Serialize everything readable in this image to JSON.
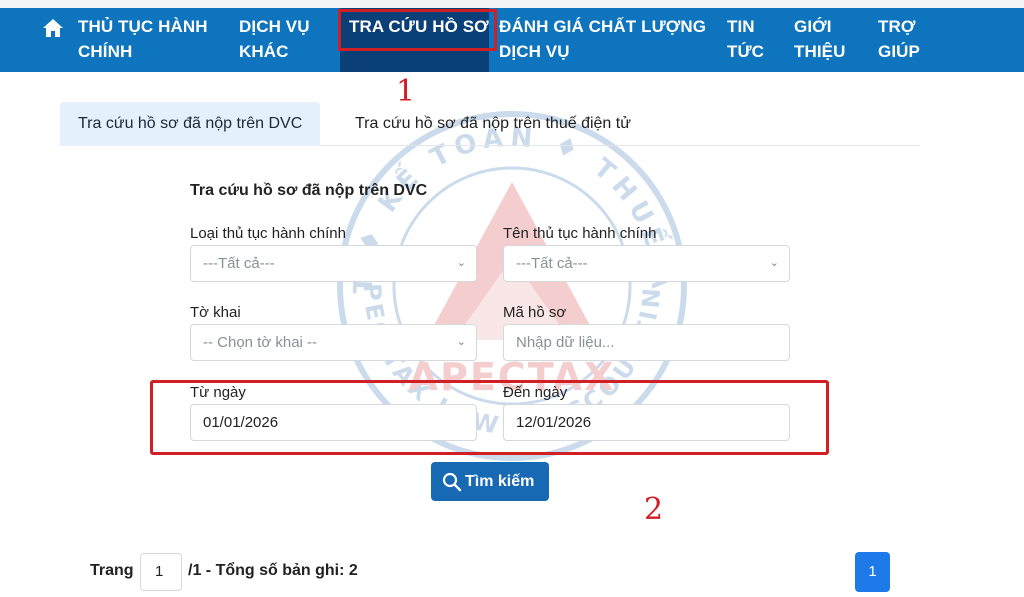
{
  "nav": {
    "home_icon": "home-icon",
    "items": [
      {
        "line1": "THỦ TỤC HÀNH",
        "line2": "CHÍNH"
      },
      {
        "line1": "DỊCH VỤ",
        "line2": "KHÁC"
      },
      {
        "line1": "TRA CỨU HỒ SƠ",
        "line2": ""
      },
      {
        "line1": "ĐÁNH GIÁ CHẤT LƯỢNG",
        "line2": "DỊCH VỤ"
      },
      {
        "line1": "TIN",
        "line2": "TỨC"
      },
      {
        "line1": "GIỚI",
        "line2": "THIỆU"
      },
      {
        "line1": "TRỢ",
        "line2": "GIÚP"
      }
    ],
    "active_color": "#0a3f78",
    "bar_color": "#0e74bd"
  },
  "annotations": {
    "step1": "1",
    "step2": "2",
    "highlight_color": "#d11f26"
  },
  "watermark": {
    "brand": "APECTAX",
    "ring_top": "LUẬT ♦ KẾ TOÁN ♦ THUẾ APEC",
    "ring_bottom": "APEC TAX LAW & ACCOUNTING"
  },
  "tabs": [
    {
      "label": "Tra cứu hồ sơ đã nộp trên DVC",
      "active": true
    },
    {
      "label": "Tra cứu hồ sơ đã nộp trên thuế điện tử",
      "active": false
    }
  ],
  "form": {
    "title": "Tra cứu hồ sơ đã nộp trên DVC",
    "loai_thu_tuc": {
      "label": "Loại thủ tục hành chính",
      "value": "---Tất cả---"
    },
    "ten_thu_tuc": {
      "label": "Tên thủ tục hành chính",
      "value": "---Tất cả---"
    },
    "to_khai": {
      "label": "Tờ khai",
      "value": "-- Chọn tờ khai --"
    },
    "ma_ho_so": {
      "label": "Mã hồ sơ",
      "placeholder": "Nhập dữ liệu..."
    },
    "tu_ngay": {
      "label": "Từ ngày",
      "value": "01/01/2026"
    },
    "den_ngay": {
      "label": "Đến ngày",
      "value": "12/01/2026"
    },
    "search_label": "Tìm kiếm"
  },
  "pager": {
    "prefix": "Trang",
    "current_page": "1",
    "suffix": "/1 - Tổng số bản ghi: 2",
    "page_button": "1"
  }
}
